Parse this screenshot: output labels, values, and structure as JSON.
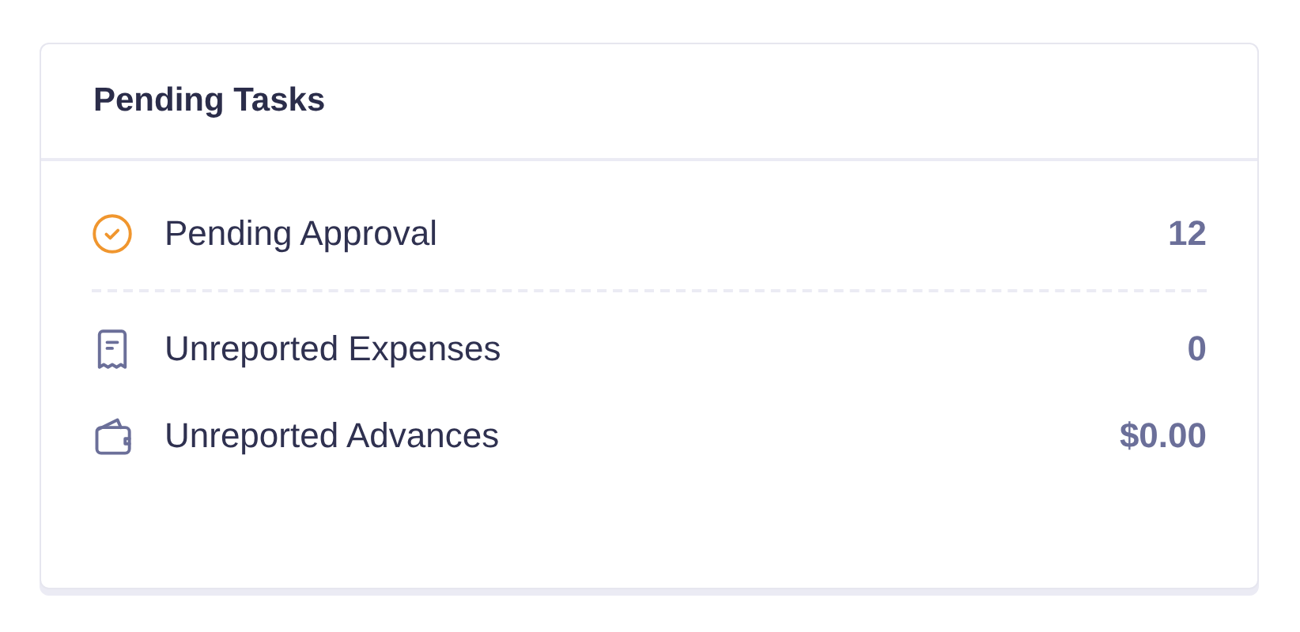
{
  "card": {
    "title": "Pending Tasks",
    "groups": [
      [
        {
          "kind": "approval",
          "label": "Pending Approval",
          "value": "12"
        }
      ],
      [
        {
          "kind": "expenses",
          "label": "Unreported Expenses",
          "value": "0"
        },
        {
          "kind": "advances",
          "label": "Unreported Advances",
          "value": "$0.00"
        }
      ]
    ]
  }
}
